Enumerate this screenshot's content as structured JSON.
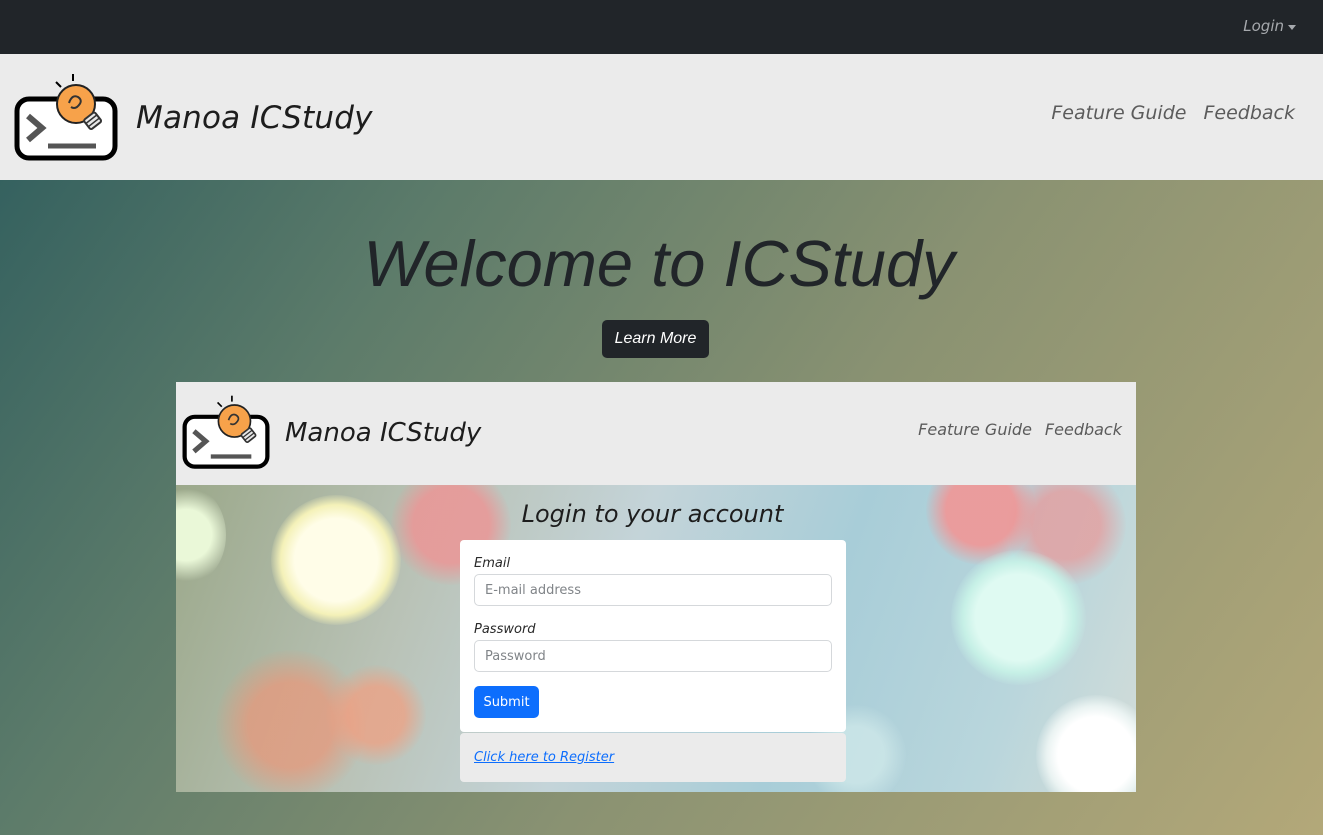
{
  "topbar": {
    "login_label": "Login"
  },
  "navbar": {
    "brand_name": "Manoa ICStudy",
    "links": [
      "Feature Guide",
      "Feedback"
    ]
  },
  "hero": {
    "title": "Welcome to ICStudy",
    "learn_more_label": "Learn More"
  },
  "preview": {
    "brand_name": "Manoa ICStudy",
    "links": [
      "Feature Guide",
      "Feedback"
    ],
    "login_heading": "Login to your account",
    "email_label": "Email",
    "email_placeholder": "E-mail address",
    "password_label": "Password",
    "password_placeholder": "Password",
    "submit_label": "Submit",
    "register_link": "Click here to Register"
  },
  "colors": {
    "topbar": "#212529",
    "navbar": "#ebebeb",
    "primary": "#0d6efd",
    "bulb": "#f7a24a"
  },
  "icons": {
    "logo": "terminal-lightbulb-icon",
    "dropdown": "caret-down-icon"
  }
}
